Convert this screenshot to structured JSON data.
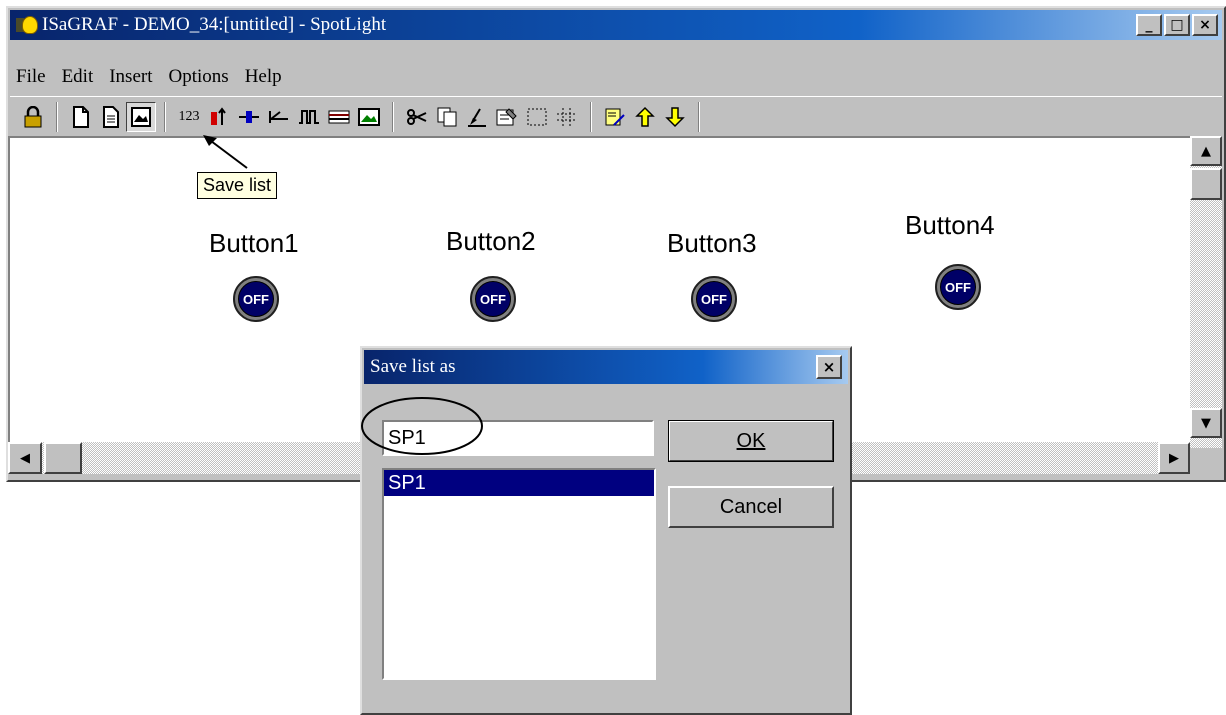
{
  "window": {
    "title": "ISaGRAF - DEMO_34:[untitled] - SpotLight",
    "controls": [
      "_",
      "□",
      "×"
    ]
  },
  "menu": [
    "File",
    "Edit",
    "Insert",
    "Options",
    "Help"
  ],
  "toolbar": {
    "number_label": "123"
  },
  "tooltip": "Save list",
  "spots": [
    {
      "label": "Button1",
      "state": "OFF"
    },
    {
      "label": "Button2",
      "state": "OFF"
    },
    {
      "label": "Button3",
      "state": "OFF"
    },
    {
      "label": "Button4",
      "state": "OFF"
    }
  ],
  "dialog": {
    "title": "Save list as",
    "close": "×",
    "input_value": "SP1",
    "list_items": [
      "SP1"
    ],
    "ok_label": "OK",
    "cancel_label": "Cancel"
  }
}
